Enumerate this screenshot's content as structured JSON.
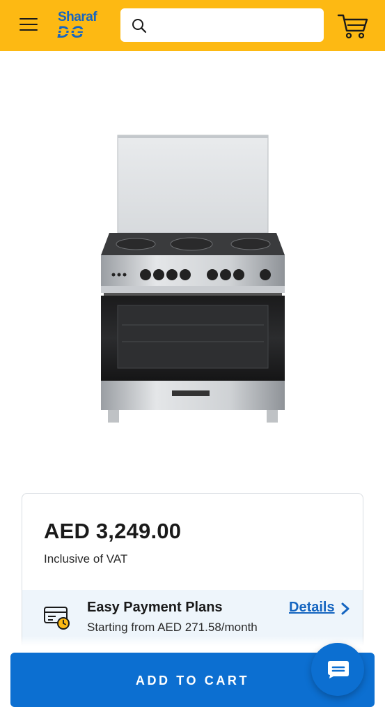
{
  "header": {
    "logo_top": "Sharaf",
    "logo_bottom": "DG",
    "search_placeholder": "",
    "brand_color": "#FDB913"
  },
  "price_card": {
    "price": "AED 3,249.00",
    "vat_note": "Inclusive of VAT",
    "emi": {
      "title": "Easy Payment Plans",
      "subtitle": "Starting from AED 271.58/month",
      "details_label": "Details"
    }
  },
  "actions": {
    "add_to_cart_label": "ADD TO CART",
    "primary_color": "#0c6fd1"
  },
  "icons": [
    "menu-icon",
    "search-icon",
    "cart-icon",
    "payment-plan-icon",
    "chevron-right-icon",
    "chat-icon"
  ]
}
